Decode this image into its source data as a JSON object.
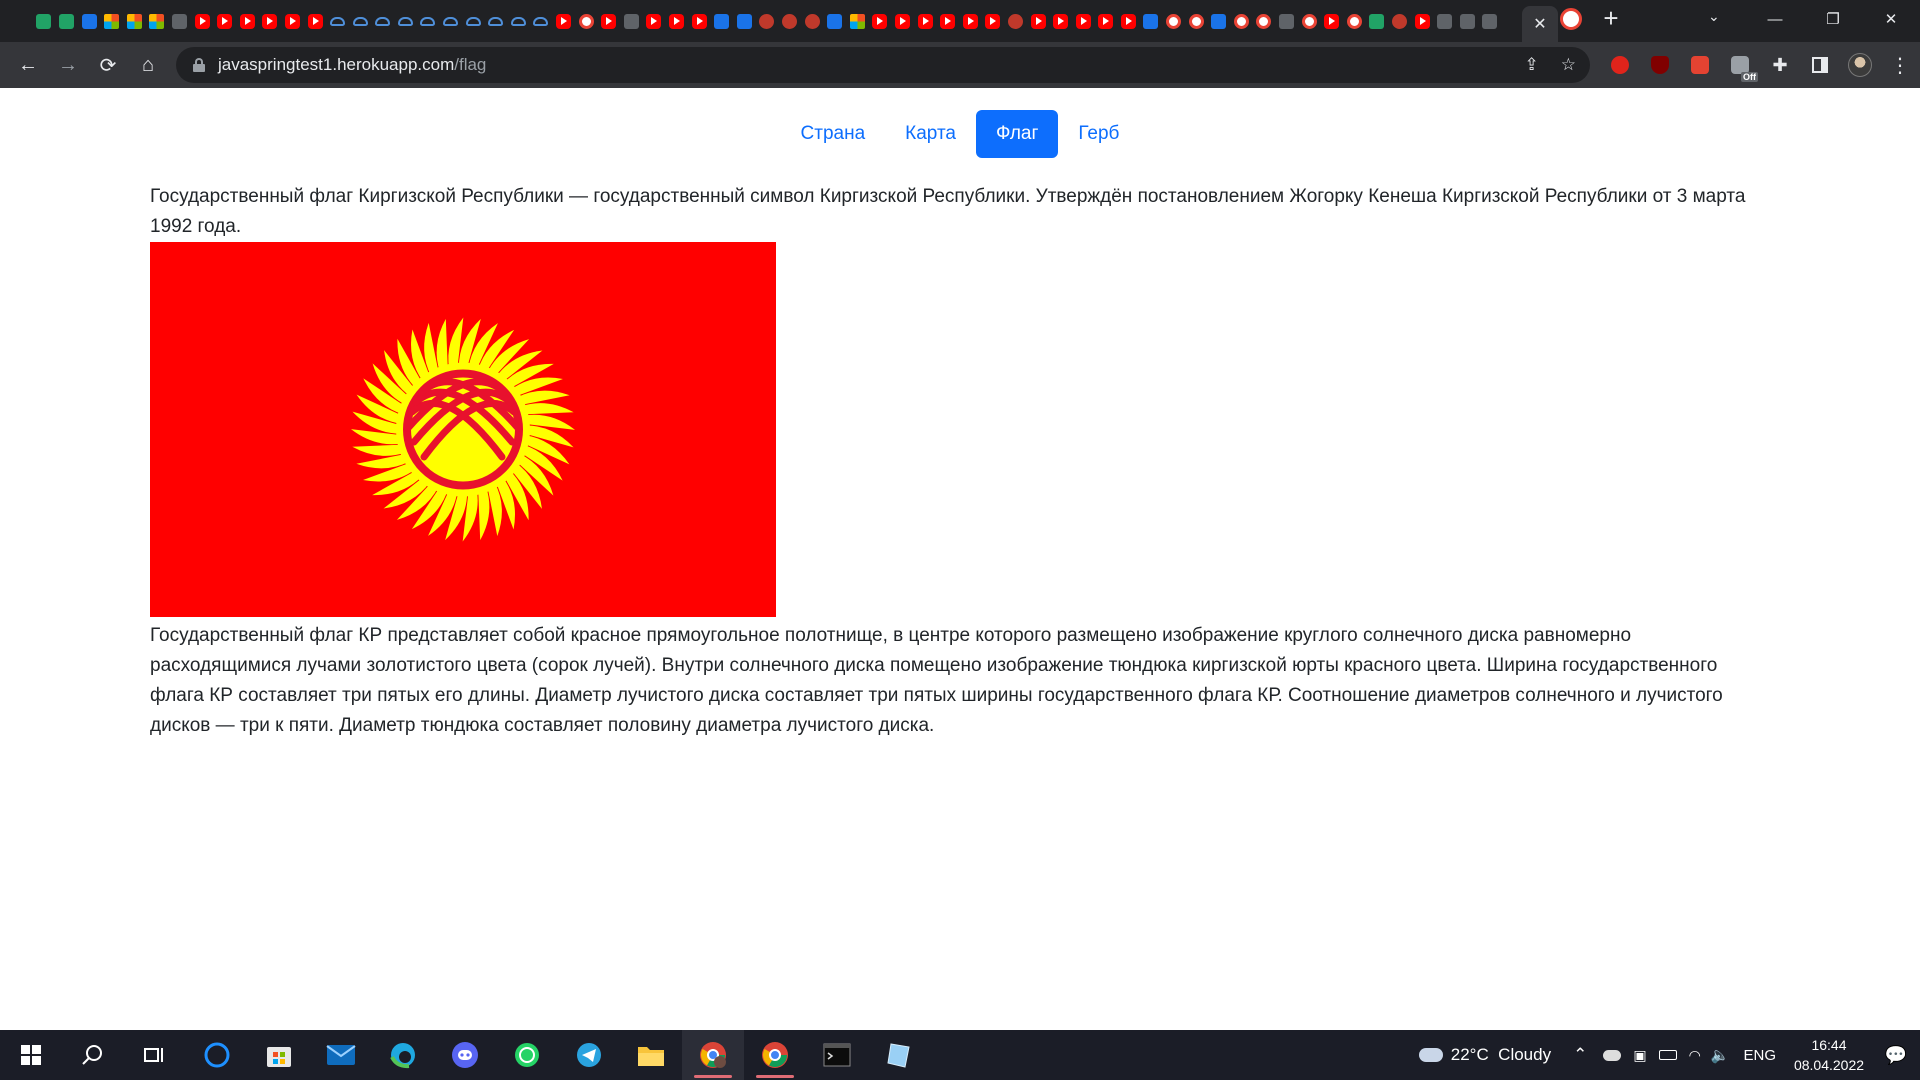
{
  "browser": {
    "tab_favicons": [
      "edge",
      "green",
      "green",
      "blue",
      "multi",
      "multi",
      "multi",
      "dark",
      "yt",
      "yt",
      "yt",
      "yt",
      "yt",
      "yt",
      "cloud",
      "cloud",
      "cloud",
      "cloud",
      "cloud",
      "cloud",
      "cloud",
      "cloud",
      "cloud",
      "cloud",
      "yt",
      "g",
      "yt",
      "dark",
      "yt",
      "yt",
      "yt",
      "blue",
      "blue",
      "red2",
      "red2",
      "red2",
      "blue",
      "multi",
      "yt",
      "yt",
      "yt",
      "yt",
      "yt",
      "yt",
      "red2",
      "yt",
      "yt",
      "yt",
      "yt",
      "yt",
      "blue",
      "g",
      "g",
      "blue",
      "g",
      "g",
      "dark",
      "g",
      "yt",
      "g",
      "green",
      "red2",
      "yt",
      "dark",
      "dark",
      "dark"
    ],
    "active_tab_close": "✕",
    "new_tab_label": "+",
    "url_host": "javaspringtest1.herokuapp.com",
    "url_path": "/flag",
    "extension_badge": "Off"
  },
  "page": {
    "nav": [
      {
        "label": "Страна",
        "active": false
      },
      {
        "label": "Карта",
        "active": false
      },
      {
        "label": "Флаг",
        "active": true
      },
      {
        "label": "Герб",
        "active": false
      }
    ],
    "intro": "Государственный флаг Киргизской Республики — государственный символ Киргизской Республики. Утверждён постановлением Жогорку Кенеша Киргизской Республики от 3 марта 1992 года.",
    "description": "Государственный флаг КР представляет собой красное прямоугольное полотнище, в центре которого размещено изображение круглого солнечного диска равномерно расходящимися лучами золотистого цвета (сорок лучей). Внутри солнечного диска помещено изображение тюндюка киргизской юрты красного цвета. Ширина государственного флага КР составляет три пятых его длины. Диаметр лучистого диска составляет три пятых ширины государственного флага КР. Соотношение диаметров солнечного и лучистого дисков — три к пяти. Диаметр тюндюка составляет половину диаметра лучистого диска.",
    "flag": {
      "field_color": "#ff0000",
      "sun_color": "#ffff00",
      "tunduk_color": "#e8112d",
      "rays": 40
    },
    "accent": "#0d6efd"
  },
  "taskbar": {
    "weather": "22°C  Cloudy",
    "lang": "ENG",
    "time": "16:44",
    "date": "08.04.2022"
  }
}
